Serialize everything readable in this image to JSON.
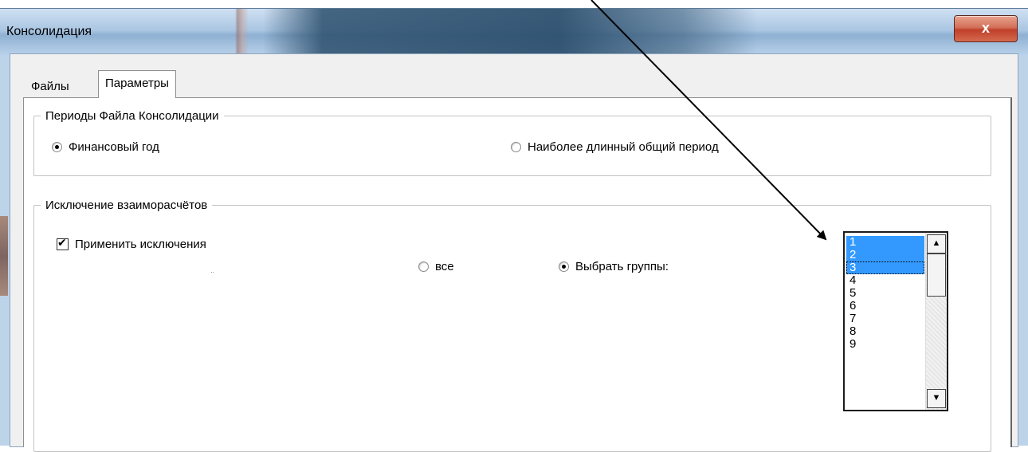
{
  "window": {
    "title": "Консолидация",
    "close_label": "x"
  },
  "tabs": [
    {
      "label": "Файлы",
      "active": false
    },
    {
      "label": "Параметры",
      "active": true
    }
  ],
  "periods_group": {
    "legend": "Периоды Файла Консолидации",
    "options": [
      {
        "label": "Финансовый год",
        "selected": true
      },
      {
        "label": "Наиболее длинный общий период",
        "selected": false
      }
    ]
  },
  "eliminations_group": {
    "legend": "Исключение взаиморасчётов",
    "apply_checkbox": {
      "label": "Применить исключения",
      "checked": true
    },
    "scope_options": [
      {
        "label": "все",
        "selected": false
      },
      {
        "label": "Выбрать группы:",
        "selected": true
      }
    ],
    "groups_list": {
      "items": [
        "1",
        "2",
        "3",
        "4",
        "5",
        "6",
        "7",
        "8",
        "9"
      ],
      "selected": [
        "1",
        "2"
      ],
      "focused": "3"
    }
  },
  "colors": {
    "selection": "#3399ff",
    "close_button": "#c0402a"
  }
}
